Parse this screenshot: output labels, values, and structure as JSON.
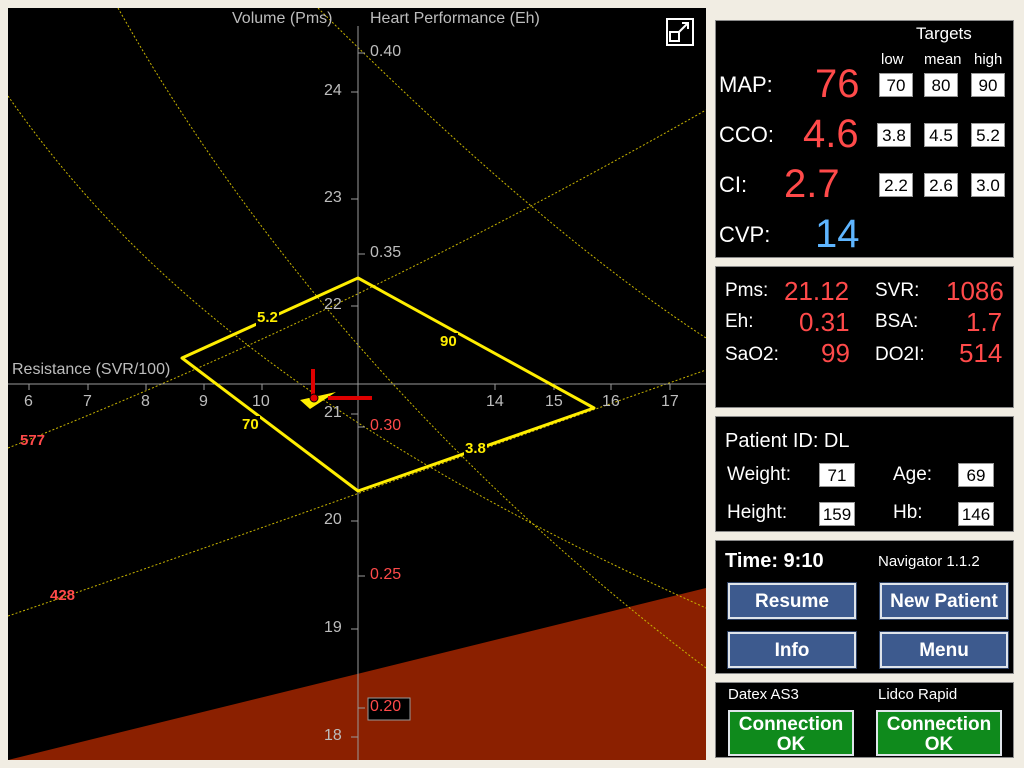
{
  "plot": {
    "volume_axis_title": "Volume (Pms)",
    "heart_axis_title": "Heart Performance (Eh)",
    "resistance_axis_title": "Resistance (SVR/100)",
    "volume_ticks": [
      "24",
      "23",
      "22",
      "21",
      "20",
      "19",
      "18"
    ],
    "resistance_ticks": [
      "6",
      "7",
      "8",
      "9",
      "10",
      "14",
      "15",
      "16",
      "17"
    ],
    "eh_ticks": [
      "0.40",
      "0.35",
      "0.30",
      "0.25",
      "0.20"
    ],
    "diamond_labels": {
      "co_high": "5.2",
      "map_high": "90",
      "map_low": "70",
      "co_low": "3.8"
    },
    "do2i_labels": [
      "577",
      "428"
    ],
    "colors": {
      "grid_curve": "#c8b400",
      "diamond": "#ffee00",
      "marker": "#e00000",
      "danger_zone": "#8b2000"
    }
  },
  "vitals": {
    "targets_title": "Targets",
    "col_headers": [
      "low",
      "mean",
      "high"
    ],
    "rows": [
      {
        "label": "MAP:",
        "value": "76",
        "low": "70",
        "mean": "80",
        "high": "90"
      },
      {
        "label": "CCO:",
        "value": "4.6",
        "low": "3.8",
        "mean": "4.5",
        "high": "5.2"
      },
      {
        "label": "CI:",
        "value": "2.7",
        "low": "2.2",
        "mean": "2.6",
        "high": "3.0"
      },
      {
        "label": "CVP:",
        "value": "14"
      }
    ]
  },
  "derived": {
    "pms_label": "Pms:",
    "pms_value": "21.12",
    "svr_label": "SVR:",
    "svr_value": "1086",
    "eh_label": "Eh:",
    "eh_value": "0.31",
    "bsa_label": "BSA:",
    "bsa_value": "1.7",
    "sao2_label": "SaO2:",
    "sao2_value": "99",
    "do2i_label": "DO2I:",
    "do2i_value": "514"
  },
  "patient": {
    "id_text": "Patient ID: DL",
    "weight_label": "Weight:",
    "weight_value": "71",
    "age_label": "Age:",
    "age_value": "69",
    "height_label": "Height:",
    "height_value": "159",
    "hb_label": "Hb:",
    "hb_value": "146"
  },
  "controls": {
    "time_text": "Time: 9:10",
    "version": "Navigator 1.1.2",
    "resume": "Resume",
    "new_patient": "New Patient",
    "info": "Info",
    "menu": "Menu"
  },
  "connections": {
    "left_device": "Datex AS3",
    "right_device": "Lidco Rapid",
    "left_status_line1": "Connection",
    "left_status_line2": "OK",
    "right_status_line1": "Connection",
    "right_status_line2": "OK"
  }
}
